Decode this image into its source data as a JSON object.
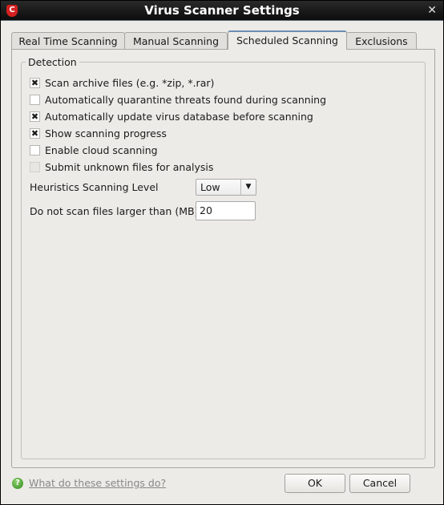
{
  "window": {
    "title": "Virus Scanner Settings",
    "close": "✕",
    "logo": "C"
  },
  "tabs": [
    {
      "label": "Real Time Scanning"
    },
    {
      "label": "Manual Scanning"
    },
    {
      "label": "Scheduled Scanning",
      "active": true
    },
    {
      "label": "Exclusions"
    }
  ],
  "detection": {
    "legend": "Detection",
    "options": [
      {
        "label": "Scan archive files (e.g. *zip, *.rar)",
        "checked": true,
        "enabled": true
      },
      {
        "label": "Automatically quarantine threats found during scanning",
        "checked": false,
        "enabled": true
      },
      {
        "label": "Automatically update virus database before scanning",
        "checked": true,
        "enabled": true
      },
      {
        "label": "Show scanning progress",
        "checked": true,
        "enabled": true
      },
      {
        "label": "Enable cloud scanning",
        "checked": false,
        "enabled": true
      },
      {
        "label": "Submit unknown files for analysis",
        "checked": false,
        "enabled": false
      }
    ],
    "heuristics_label": "Heuristics Scanning Level",
    "heuristics_value": "Low",
    "max_size_label": "Do not scan files larger than (MB)",
    "max_size_value": "20"
  },
  "footer": {
    "help_link": "What do these settings do?",
    "help_icon": "question-icon",
    "ok": "OK",
    "cancel": "Cancel"
  }
}
